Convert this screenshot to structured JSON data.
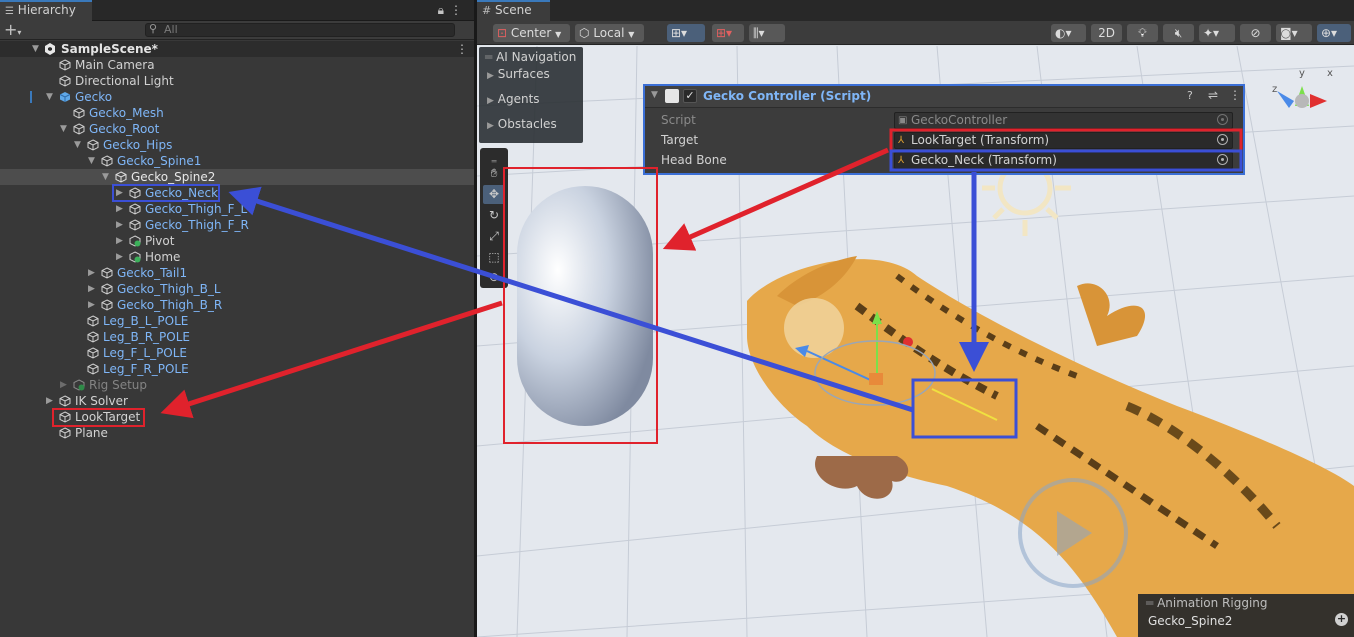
{
  "hierarchy": {
    "tab_label": "Hierarchy",
    "search_placeholder": "All",
    "rows": [
      {
        "label": "SampleScene*",
        "depth": 0
      },
      {
        "label": "Main Camera",
        "depth": 1
      },
      {
        "label": "Directional Light",
        "depth": 1
      },
      {
        "label": "Gecko",
        "depth": 1
      },
      {
        "label": "Gecko_Mesh",
        "depth": 2
      },
      {
        "label": "Gecko_Root",
        "depth": 2
      },
      {
        "label": "Gecko_Hips",
        "depth": 3
      },
      {
        "label": "Gecko_Spine1",
        "depth": 4
      },
      {
        "label": "Gecko_Spine2",
        "depth": 5
      },
      {
        "label": "Gecko_Neck",
        "depth": 6
      },
      {
        "label": "Gecko_Thigh_F_L",
        "depth": 6
      },
      {
        "label": "Gecko_Thigh_F_R",
        "depth": 6
      },
      {
        "label": "Pivot",
        "depth": 6
      },
      {
        "label": "Home",
        "depth": 6
      },
      {
        "label": "Gecko_Tail1",
        "depth": 4
      },
      {
        "label": "Gecko_Thigh_B_L",
        "depth": 4
      },
      {
        "label": "Gecko_Thigh_B_R",
        "depth": 4
      },
      {
        "label": "Leg_B_L_POLE",
        "depth": 3
      },
      {
        "label": "Leg_B_R_POLE",
        "depth": 3
      },
      {
        "label": "Leg_F_L_POLE",
        "depth": 3
      },
      {
        "label": "Leg_F_R_POLE",
        "depth": 3
      },
      {
        "label": "Rig Setup",
        "depth": 2
      },
      {
        "label": "IK Solver",
        "depth": 1
      },
      {
        "label": "LookTarget",
        "depth": 1
      },
      {
        "label": "Plane",
        "depth": 1
      }
    ]
  },
  "scene": {
    "tab_label": "Scene",
    "toolbar": {
      "pivot_mode": "Center",
      "pivot_rotation": "Local",
      "mode_2d": "2D"
    },
    "ai_navigation": {
      "title": "AI Navigation",
      "items": [
        "Surfaces",
        "Agents",
        "Obstacles"
      ]
    },
    "inspector": {
      "component_title": "Gecko Controller (Script)",
      "script_label": "Script",
      "script_value": "GeckoController",
      "target_label": "Target",
      "target_value": "LookTarget (Transform)",
      "headbone_label": "Head Bone",
      "headbone_value": "Gecko_Neck (Transform)"
    },
    "animation_rigging": {
      "title": "Animation Rigging",
      "value": "Gecko_Spine2"
    }
  },
  "colors": {
    "accent_blue": "#3b4fd6",
    "highlight_red": "#e0222c",
    "selection_text": "#7fb6f7"
  }
}
